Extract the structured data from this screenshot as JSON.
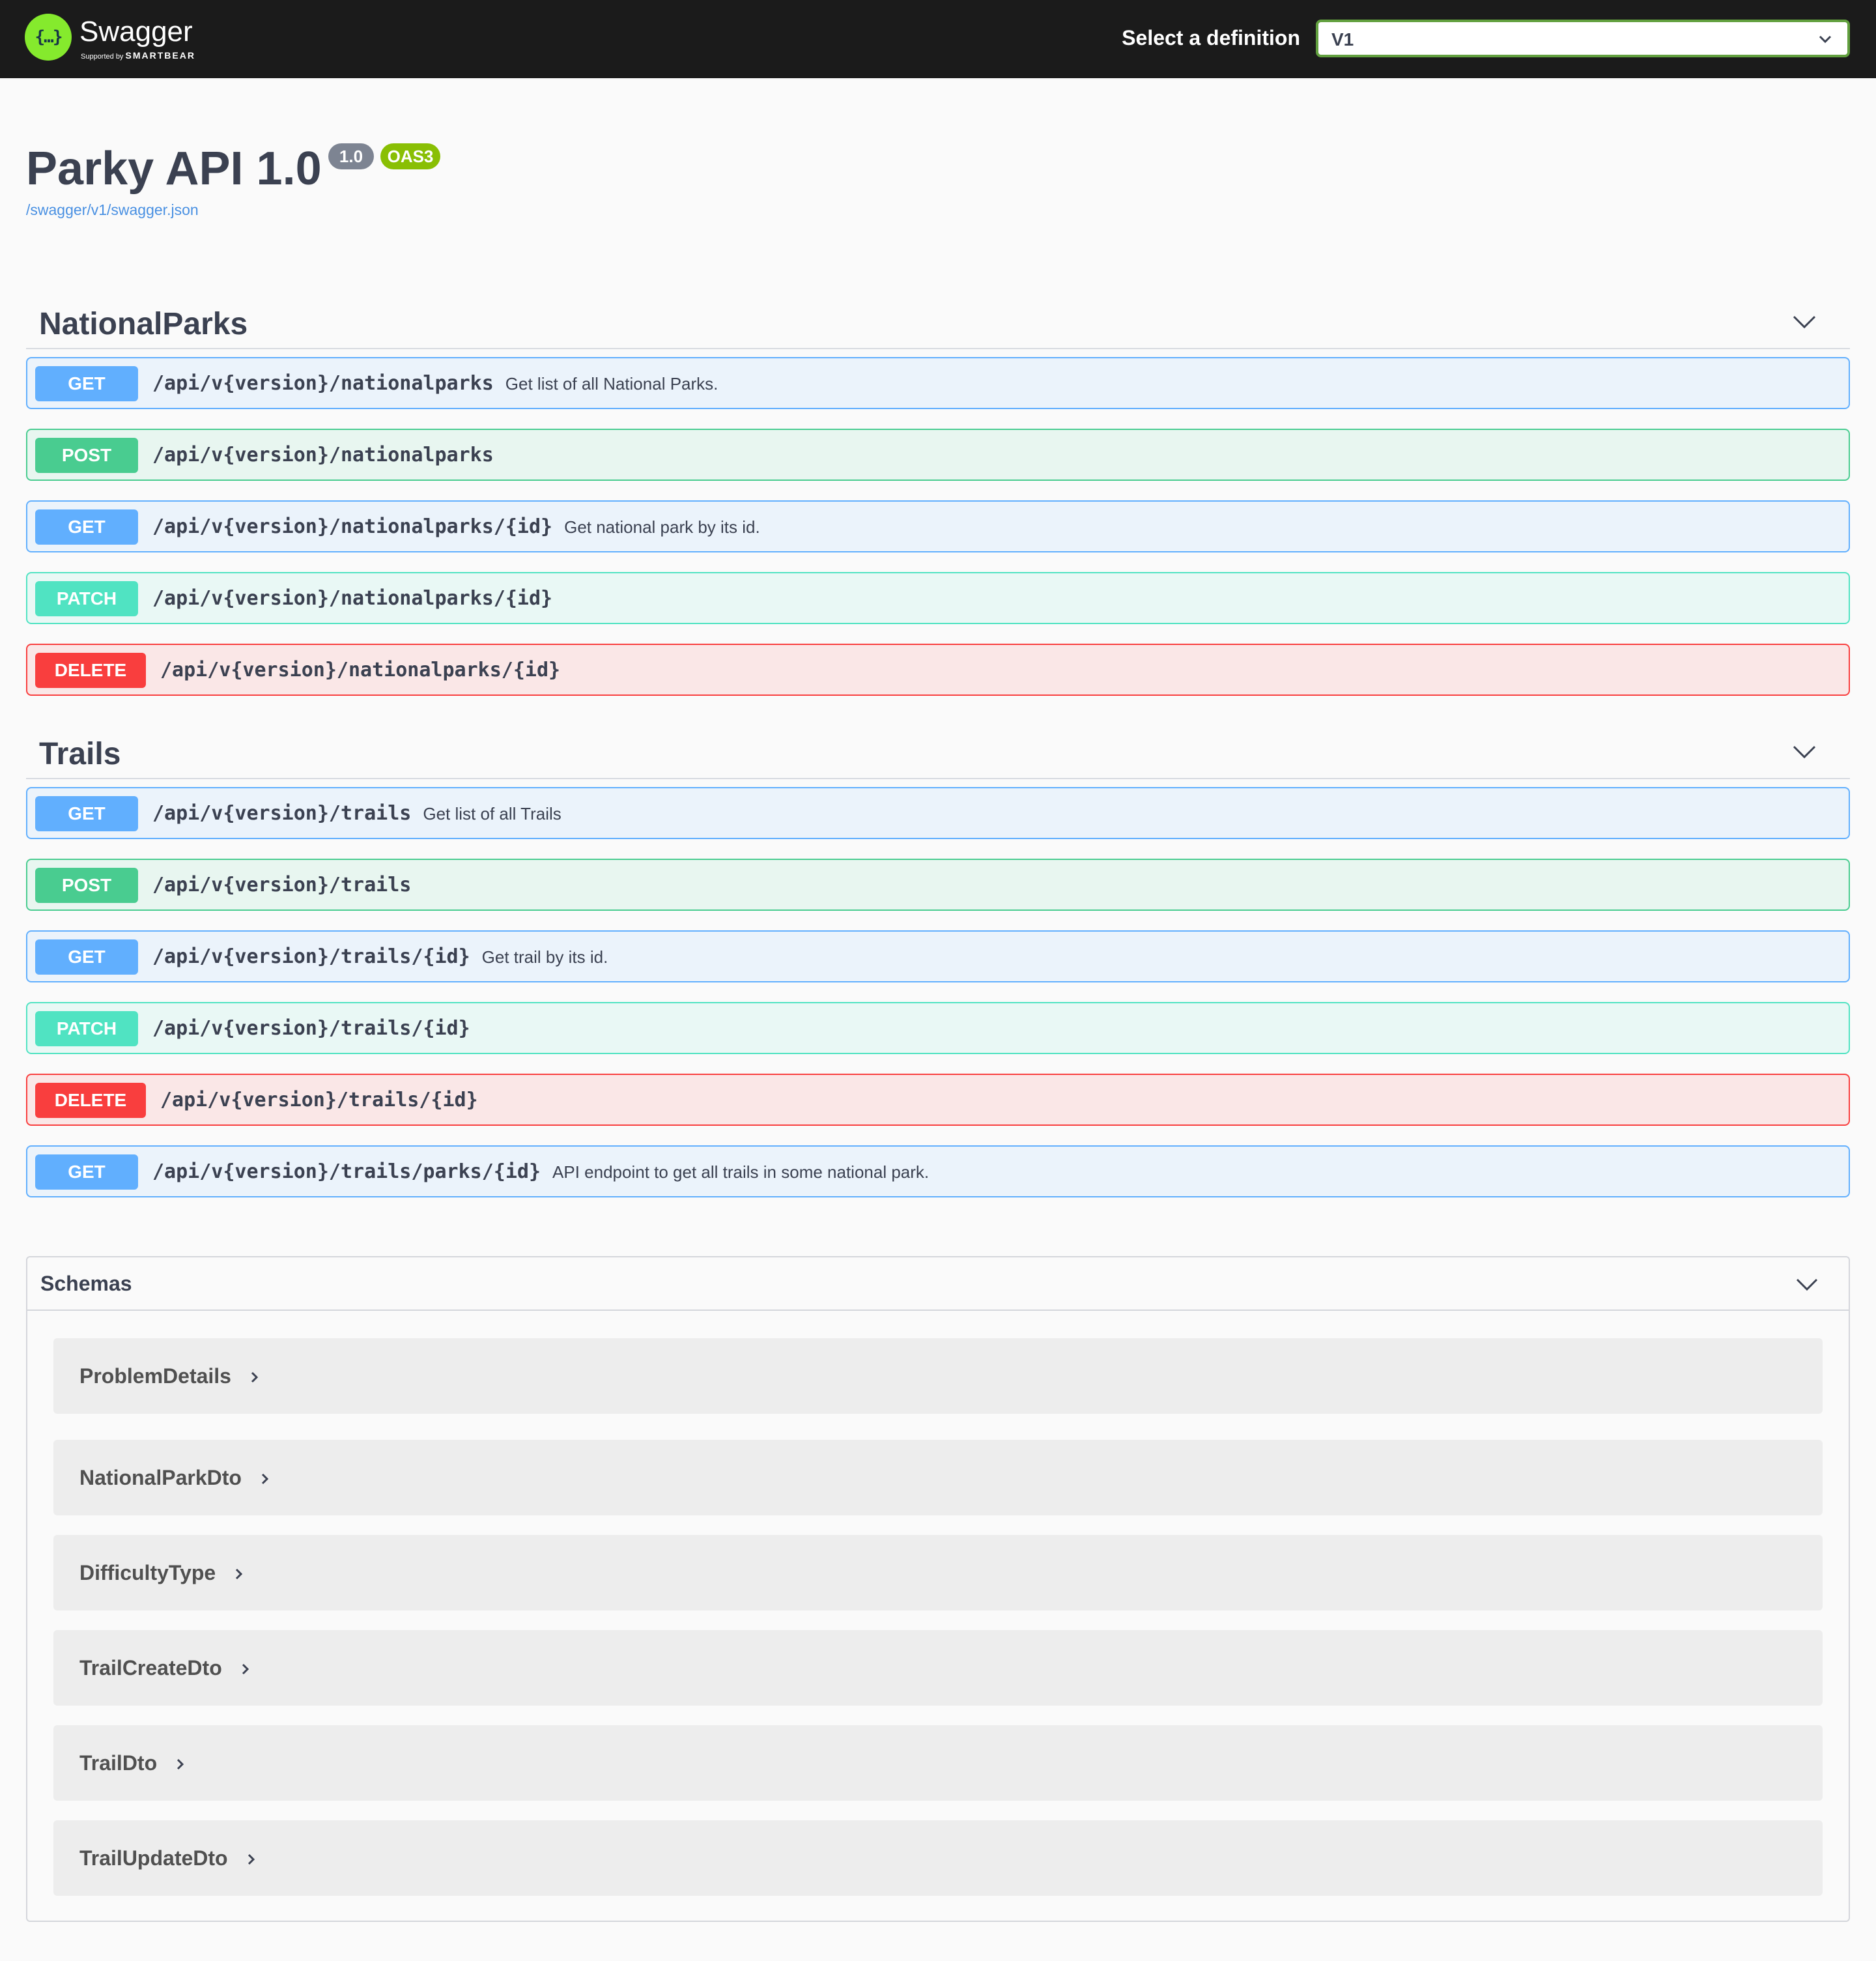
{
  "topbar": {
    "logo_text": "Swagger",
    "logo_glyph": "{…}",
    "logo_sub_prefix": "Supported by",
    "logo_sub_brand": "SMARTBEAR",
    "definition_label": "Select a definition",
    "definition_value": "V1",
    "accent_color": "#85ea2d"
  },
  "info": {
    "title": "Parky API 1.0",
    "version_badge": "1.0",
    "oas_badge": "OAS3",
    "spec_url": "/swagger/v1/swagger.json"
  },
  "tags": [
    {
      "name": "NationalParks",
      "operations": [
        {
          "method": "GET",
          "path": "/api/v{version}/nationalparks",
          "summary": "Get list of all National Parks."
        },
        {
          "method": "POST",
          "path": "/api/v{version}/nationalparks",
          "summary": ""
        },
        {
          "method": "GET",
          "path": "/api/v{version}/nationalparks/{id}",
          "summary": "Get national park by its id."
        },
        {
          "method": "PATCH",
          "path": "/api/v{version}/nationalparks/{id}",
          "summary": ""
        },
        {
          "method": "DELETE",
          "path": "/api/v{version}/nationalparks/{id}",
          "summary": ""
        }
      ]
    },
    {
      "name": "Trails",
      "operations": [
        {
          "method": "GET",
          "path": "/api/v{version}/trails",
          "summary": "Get list of all Trails"
        },
        {
          "method": "POST",
          "path": "/api/v{version}/trails",
          "summary": ""
        },
        {
          "method": "GET",
          "path": "/api/v{version}/trails/{id}",
          "summary": "Get trail by its id."
        },
        {
          "method": "PATCH",
          "path": "/api/v{version}/trails/{id}",
          "summary": ""
        },
        {
          "method": "DELETE",
          "path": "/api/v{version}/trails/{id}",
          "summary": ""
        },
        {
          "method": "GET",
          "path": "/api/v{version}/trails/parks/{id}",
          "summary": "API endpoint to get all trails in some national park."
        }
      ]
    }
  ],
  "schemas": {
    "title": "Schemas",
    "models": [
      "ProblemDetails",
      "NationalParkDto",
      "DifficultyType",
      "TrailCreateDto",
      "TrailDto",
      "TrailUpdateDto"
    ]
  },
  "method_colors": {
    "GET": "#61affe",
    "POST": "#49cc90",
    "PATCH": "#50e3c2",
    "DELETE": "#f93e3e"
  }
}
